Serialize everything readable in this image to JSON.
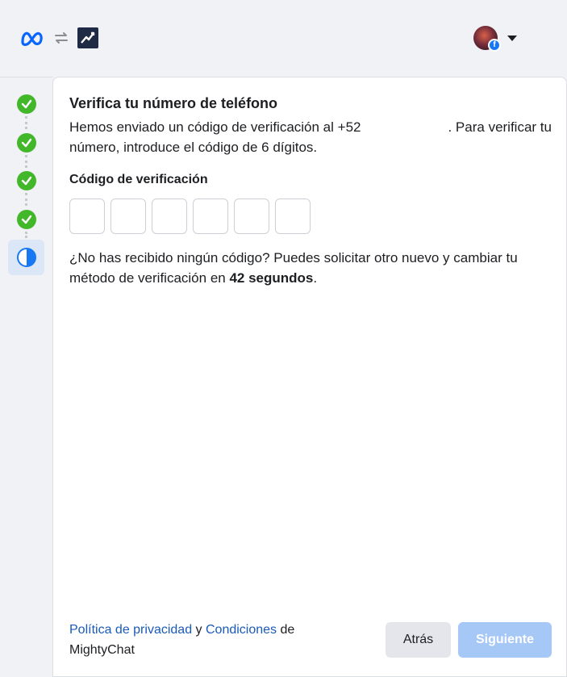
{
  "header": {
    "brand_icons": [
      "meta-logo",
      "swap-icon",
      "mightychat-logo"
    ],
    "account_icons": [
      "avatar",
      "facebook-badge",
      "dropdown-caret"
    ]
  },
  "steps": [
    {
      "status": "complete",
      "icon": "check-icon"
    },
    {
      "status": "complete",
      "icon": "check-icon"
    },
    {
      "status": "complete",
      "icon": "check-icon"
    },
    {
      "status": "complete",
      "icon": "check-icon"
    },
    {
      "status": "in-progress",
      "icon": "half-circle-icon"
    }
  ],
  "main": {
    "title": "Verifica tu número de teléfono",
    "desc_part1": "Hemos enviado un código de verificación al +52",
    "desc_part2": ". Para verificar tu número, introduce el código de 6 dígitos.",
    "code_label": "Código de verificación",
    "code_digits": [
      "",
      "",
      "",
      "",
      "",
      ""
    ],
    "resend_part1": "¿No has recibido ningún código? Puedes solicitar otro nuevo y cambiar tu método de verificación en",
    "resend_countdown": "42 segundos",
    "resend_part2": "."
  },
  "footer": {
    "privacy_link": "Política de privacidad",
    "conjunction": "y",
    "terms_link": "Condiciones",
    "suffix": "de MightyChat",
    "back_button": "Atrás",
    "next_button": "Siguiente"
  },
  "colors": {
    "accent": "#1877f2",
    "link": "#1a5ab8",
    "success": "#42b72a",
    "next_disabled": "#a6c8f7",
    "background": "#f0f2f5"
  }
}
